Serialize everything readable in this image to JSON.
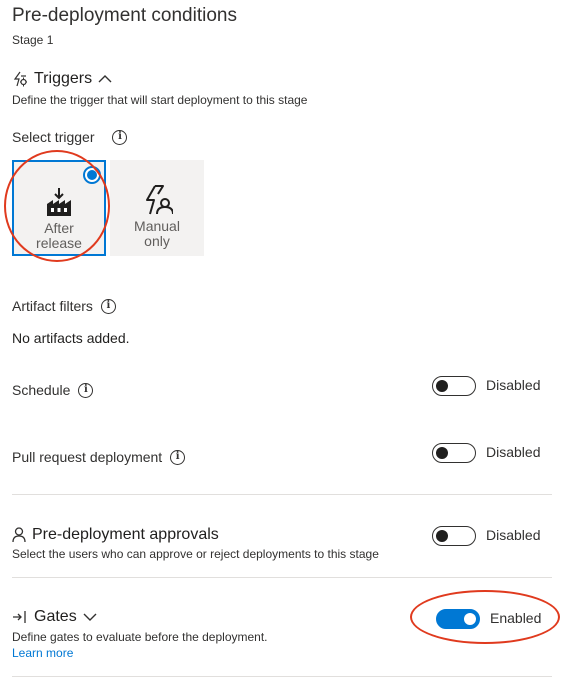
{
  "header": {
    "title": "Pre-deployment conditions",
    "subtitle": "Stage 1"
  },
  "triggers": {
    "title": "Triggers",
    "description": "Define the trigger that will start deployment to this stage",
    "select_label": "Select trigger",
    "options": [
      {
        "line1": "After",
        "line2": "release",
        "selected": true
      },
      {
        "line1": "Manual",
        "line2": "only",
        "selected": false
      }
    ]
  },
  "artifact_filters": {
    "label": "Artifact filters",
    "empty_text": "No artifacts added."
  },
  "schedule": {
    "label": "Schedule",
    "state": "Disabled"
  },
  "pull_request": {
    "label": "Pull request deployment",
    "state": "Disabled"
  },
  "approvals": {
    "title": "Pre-deployment approvals",
    "description": "Select the users who can approve or reject deployments to this stage",
    "state": "Disabled"
  },
  "gates": {
    "title": "Gates",
    "description": "Define gates to evaluate before the deployment.",
    "learn_more": "Learn more",
    "state": "Enabled"
  },
  "colors": {
    "accent": "#0078d4",
    "annotation": "#e03a1e"
  },
  "icons": {
    "triggers": "lightning-bolt-icon",
    "collapse": "chevron-up-icon",
    "expand": "chevron-down-icon",
    "info": "info-icon",
    "after_release": "factory-download-icon",
    "manual": "lightning-person-icon",
    "approvals": "person-icon",
    "gates": "gate-arrow-icon"
  }
}
